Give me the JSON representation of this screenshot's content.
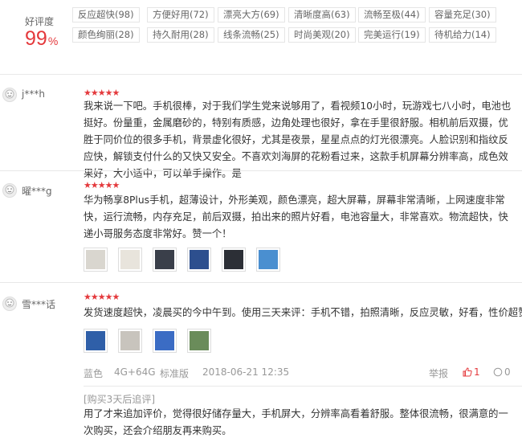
{
  "summary": {
    "rate_label": "好评度",
    "rate_value": "99",
    "rate_unit": "%",
    "tags": [
      "反应超快(98)",
      "方便好用(72)",
      "漂亮大方(69)",
      "清晰度高(63)",
      "流畅至极(44)",
      "容量充足(30)",
      "颜色绚丽(28)",
      "持久耐用(28)",
      "线条流畅(25)",
      "时尚美观(20)",
      "完美运行(19)",
      "待机给力(14)"
    ]
  },
  "reviews": [
    {
      "user": "j***h",
      "stars": "★★★★★",
      "content": "我来说一下吧。手机很棒，对于我们学生党来说够用了，看视频10小时，玩游戏七八小时，电池也挺好。份量重，金属磨砂的，特别有质感，边角处理也很好，拿在手里很舒服。相机前后双摄，优胜于同价位的很多手机，背景虚化很好，尤其是夜景，星星点点的灯光很漂亮。人脸识别和指纹反应快，解锁支付什么的又快又安全。不喜欢刘海屏的花粉看过来，这款手机屏幕分辨率高，成色效果好，大小适中，可以单手操作。是"
    },
    {
      "user": "曜***g",
      "stars": "★★★★★",
      "content": "华为畅享8Plus手机，超薄设计，外形美观，颜色漂亮，超大屏幕，屏幕非常清晰，上网速度非常快，运行流畅，内存充足，前后双摄，拍出来的照片好看，电池容量大，非常喜欢。物流超快，快递小哥服务态度非常好。赞一个！",
      "thumb_colors": [
        "#d9d6cf",
        "#e8e4dc",
        "#3a3f4a",
        "#2d4f8e",
        "#2c2f36",
        "#4a8fd0"
      ]
    },
    {
      "user": "雪***话",
      "stars": "★★★★★",
      "content": "发货速度超快，凌晨买的今中午到。使用三天来评：手机不错，拍照清晰，反应灵敏，好看，性价超赞",
      "thumb_colors": [
        "#2f5fa8",
        "#c8c4bd",
        "#3b6cc4",
        "#6a8c5a"
      ],
      "meta": {
        "color": "蓝色",
        "spec": "4G+64G",
        "edition": "标准版",
        "date": "2018-06-21 12:35"
      },
      "actions": {
        "report": "举报",
        "likes": "1",
        "comments": "0"
      },
      "followup_title": "[购买3天后追评]",
      "followup": "用了才来追加评价，觉得很好储存量大，手机屏大，分辨率高看着舒服。整体很流畅，很满意的一次购买，还会介绍朋友再来购买。"
    }
  ]
}
